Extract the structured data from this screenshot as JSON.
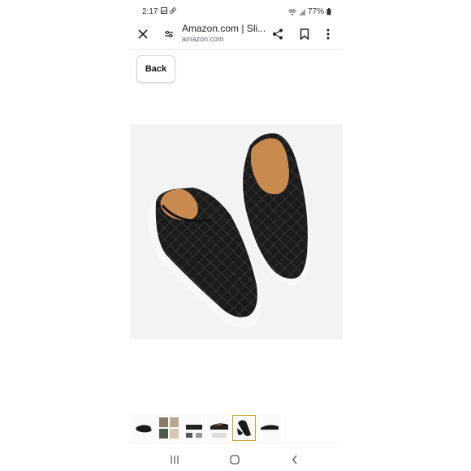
{
  "status_bar": {
    "time": "2:17",
    "battery": "77%"
  },
  "browser": {
    "page_title": "Amazon.com | Sli...",
    "domain": "amazon.com"
  },
  "page": {
    "back_label": "Back"
  },
  "product_image": {
    "description_icon": "quilted-slip-on-shoe-icon",
    "background": "#f3f3f3",
    "shoe_color": "#1a1a1a",
    "lining_color": "#c98a4f"
  },
  "thumbnails": {
    "count": 6,
    "selected_index": 4,
    "selected_border": "#c9a227"
  },
  "nav": {
    "recents": "|||",
    "home": "○",
    "back": "‹"
  }
}
